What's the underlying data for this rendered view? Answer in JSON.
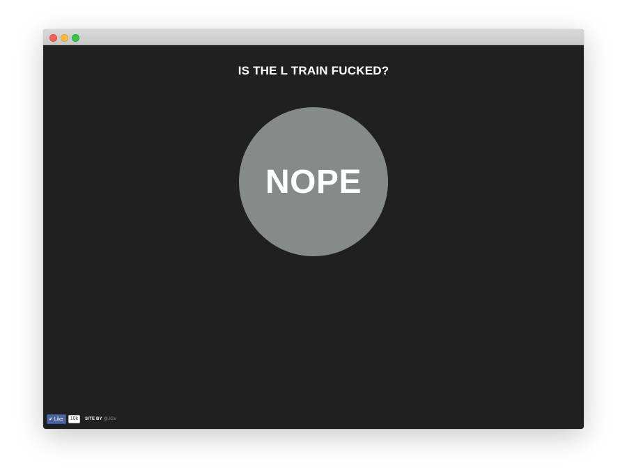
{
  "page": {
    "headline": "IS THE L TRAIN FUCKED?",
    "answer": "NOPE"
  },
  "footer": {
    "like_label": "Like",
    "like_count": "10k",
    "credit_label": "SITE BY",
    "credit_handle": "@JGV"
  },
  "icons": {
    "like": "checkmark-icon"
  },
  "colors": {
    "background": "#202020",
    "circle": "#868a88",
    "text": "#ffffff",
    "facebook": "#4a66a0"
  }
}
